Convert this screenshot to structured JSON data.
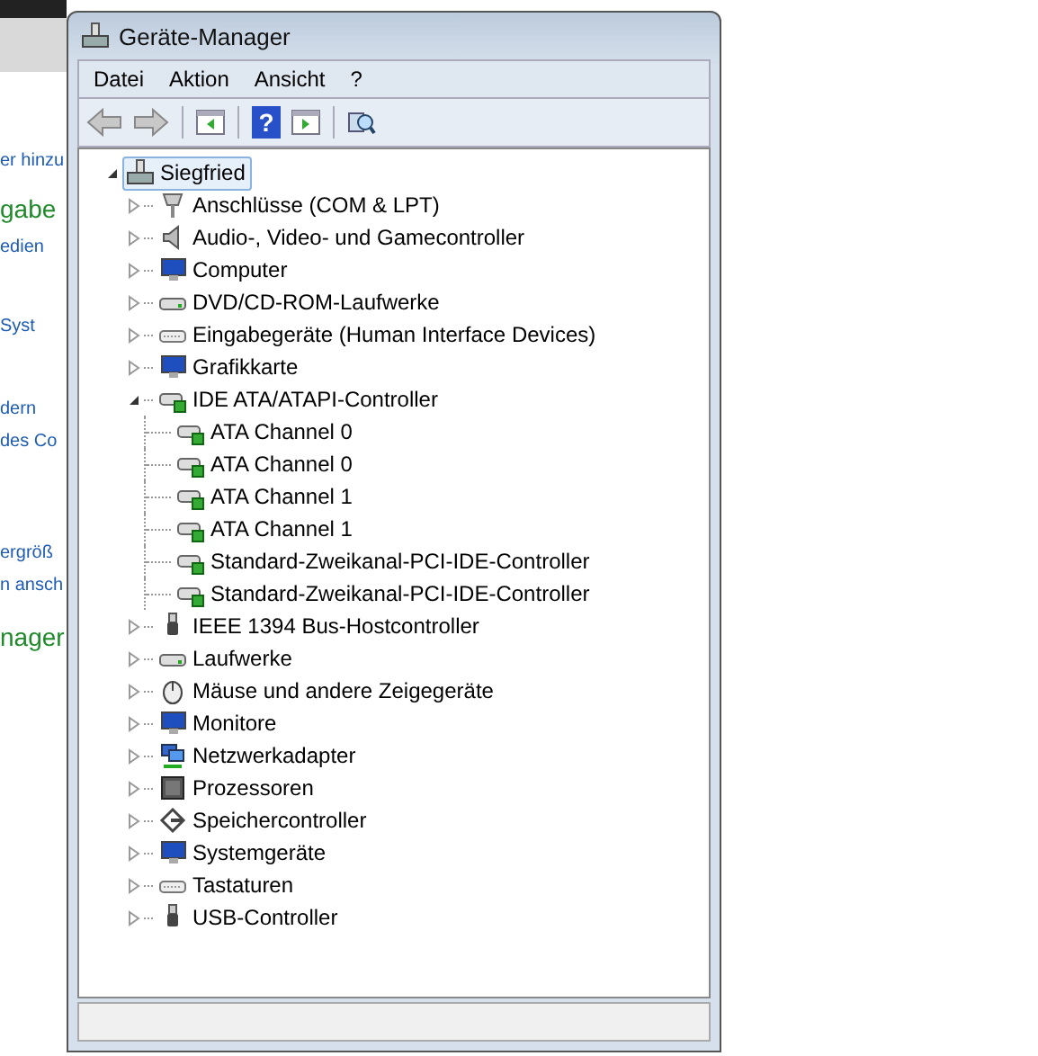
{
  "background_window": {
    "texts": [
      {
        "kind": "link",
        "text": "er hinzu"
      },
      {
        "kind": "heading",
        "text": "gabe"
      },
      {
        "kind": "link",
        "text": "edien"
      },
      {
        "kind": "link",
        "text": "Syst"
      },
      {
        "kind": "link",
        "text": "dern"
      },
      {
        "kind": "link",
        "text": "des Co"
      },
      {
        "kind": "link",
        "text": "ergröß"
      },
      {
        "kind": "link",
        "text": "n ansch"
      },
      {
        "kind": "heading",
        "text": "nager"
      }
    ]
  },
  "window": {
    "title": "Geräte-Manager"
  },
  "menu": [
    "Datei",
    "Aktion",
    "Ansicht",
    "?"
  ],
  "toolbar": [
    {
      "kind": "back",
      "disabled": true
    },
    {
      "kind": "forward",
      "disabled": true
    },
    {
      "kind": "pane"
    },
    {
      "kind": "help",
      "label": "?"
    },
    {
      "kind": "action-pane"
    },
    {
      "kind": "scan"
    }
  ],
  "tree": {
    "label": "Siegfried",
    "expanded": true,
    "selected": true,
    "children": [
      {
        "label": "Anschlüsse (COM & LPT)",
        "expanded": false,
        "selected": false
      },
      {
        "label": "Audio-, Video- und Gamecontroller",
        "expanded": false,
        "selected": false
      },
      {
        "label": "Computer",
        "expanded": false,
        "selected": false
      },
      {
        "label": "DVD/CD-ROM-Laufwerke",
        "expanded": false,
        "selected": false
      },
      {
        "label": "Eingabegeräte (Human Interface Devices)",
        "expanded": false,
        "selected": false
      },
      {
        "label": "Grafikkarte",
        "expanded": false,
        "selected": false
      },
      {
        "label": "IDE ATA/ATAPI-Controller",
        "expanded": true,
        "selected": false,
        "children": [
          {
            "label": "ATA Channel 0",
            "selected": false
          },
          {
            "label": "ATA Channel 0",
            "selected": false
          },
          {
            "label": "ATA Channel 1",
            "selected": false
          },
          {
            "label": "ATA Channel 1",
            "selected": false
          },
          {
            "label": "Standard-Zweikanal-PCI-IDE-Controller",
            "selected": false
          },
          {
            "label": "Standard-Zweikanal-PCI-IDE-Controller",
            "selected": false
          }
        ]
      },
      {
        "label": "IEEE 1394 Bus-Hostcontroller",
        "expanded": false,
        "selected": false
      },
      {
        "label": "Laufwerke",
        "expanded": false,
        "selected": false
      },
      {
        "label": "Mäuse und andere Zeigegeräte",
        "expanded": false,
        "selected": false
      },
      {
        "label": "Monitore",
        "expanded": false,
        "selected": false
      },
      {
        "label": "Netzwerkadapter",
        "expanded": false,
        "selected": false
      },
      {
        "label": "Prozessoren",
        "expanded": false,
        "selected": false
      },
      {
        "label": "Speichercontroller",
        "expanded": false,
        "selected": false
      },
      {
        "label": "Systemgeräte",
        "expanded": false,
        "selected": false
      },
      {
        "label": "Tastaturen",
        "expanded": false,
        "selected": false
      },
      {
        "label": "USB-Controller",
        "expanded": false,
        "selected": false
      }
    ]
  }
}
